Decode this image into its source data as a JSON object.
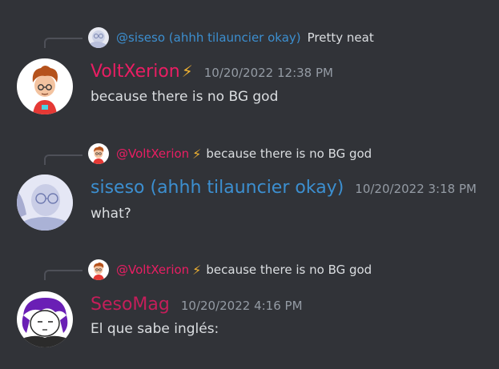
{
  "colors": {
    "background": "#313338",
    "voltxerion_name": "#e91e63",
    "siseso_name": "#3c8fd0",
    "sesomag_name": "#c41e5a",
    "text": "#dbdee1",
    "muted": "#949ba4",
    "bolt": "#f0b232"
  },
  "messages": [
    {
      "reply": {
        "avatar_icon": "siseso-avatar-icon",
        "name": "@siseso (ahhh tilauncier okay)",
        "text": "Pretty neat"
      },
      "author": "VoltXerion",
      "author_badge": "⚡",
      "timestamp": "10/20/2022 12:38 PM",
      "content": "because there is no BG god",
      "avatar_icon": "voltxerion-avatar-icon"
    },
    {
      "reply": {
        "avatar_icon": "voltxerion-avatar-icon",
        "name": "@VoltXerion",
        "badge": "⚡",
        "text": "because there is no BG god"
      },
      "author": "siseso (ahhh tilauncier okay)",
      "timestamp": "10/20/2022 3:18 PM",
      "content": "what?",
      "avatar_icon": "siseso-avatar-icon"
    },
    {
      "reply": {
        "avatar_icon": "voltxerion-avatar-icon",
        "name": "@VoltXerion",
        "badge": "⚡",
        "text": "because there is no BG god"
      },
      "author": "SesoMag",
      "timestamp": "10/20/2022 4:16 PM",
      "content": "El que sabe inglés:",
      "avatar_icon": "sesomag-avatar-icon"
    }
  ]
}
